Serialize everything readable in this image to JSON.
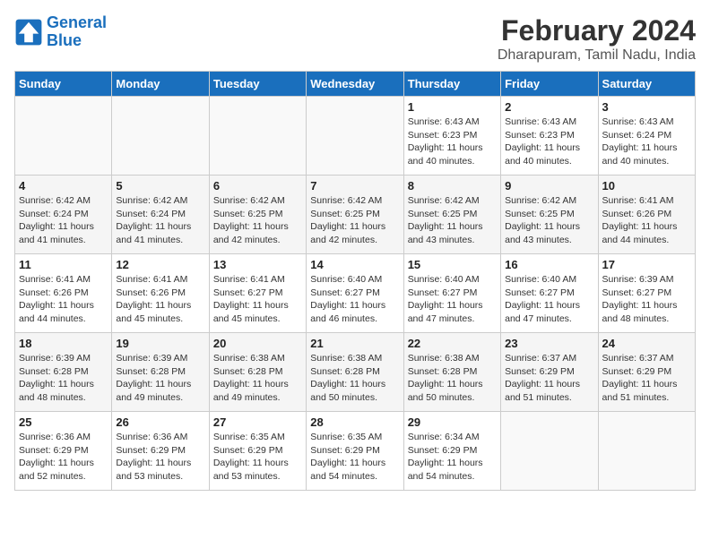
{
  "header": {
    "logo_line1": "General",
    "logo_line2": "Blue",
    "month": "February 2024",
    "location": "Dharapuram, Tamil Nadu, India"
  },
  "weekdays": [
    "Sunday",
    "Monday",
    "Tuesday",
    "Wednesday",
    "Thursday",
    "Friday",
    "Saturday"
  ],
  "weeks": [
    [
      {
        "day": "",
        "info": ""
      },
      {
        "day": "",
        "info": ""
      },
      {
        "day": "",
        "info": ""
      },
      {
        "day": "",
        "info": ""
      },
      {
        "day": "1",
        "info": "Sunrise: 6:43 AM\nSunset: 6:23 PM\nDaylight: 11 hours and 40 minutes."
      },
      {
        "day": "2",
        "info": "Sunrise: 6:43 AM\nSunset: 6:23 PM\nDaylight: 11 hours and 40 minutes."
      },
      {
        "day": "3",
        "info": "Sunrise: 6:43 AM\nSunset: 6:24 PM\nDaylight: 11 hours and 40 minutes."
      }
    ],
    [
      {
        "day": "4",
        "info": "Sunrise: 6:42 AM\nSunset: 6:24 PM\nDaylight: 11 hours and 41 minutes."
      },
      {
        "day": "5",
        "info": "Sunrise: 6:42 AM\nSunset: 6:24 PM\nDaylight: 11 hours and 41 minutes."
      },
      {
        "day": "6",
        "info": "Sunrise: 6:42 AM\nSunset: 6:25 PM\nDaylight: 11 hours and 42 minutes."
      },
      {
        "day": "7",
        "info": "Sunrise: 6:42 AM\nSunset: 6:25 PM\nDaylight: 11 hours and 42 minutes."
      },
      {
        "day": "8",
        "info": "Sunrise: 6:42 AM\nSunset: 6:25 PM\nDaylight: 11 hours and 43 minutes."
      },
      {
        "day": "9",
        "info": "Sunrise: 6:42 AM\nSunset: 6:25 PM\nDaylight: 11 hours and 43 minutes."
      },
      {
        "day": "10",
        "info": "Sunrise: 6:41 AM\nSunset: 6:26 PM\nDaylight: 11 hours and 44 minutes."
      }
    ],
    [
      {
        "day": "11",
        "info": "Sunrise: 6:41 AM\nSunset: 6:26 PM\nDaylight: 11 hours and 44 minutes."
      },
      {
        "day": "12",
        "info": "Sunrise: 6:41 AM\nSunset: 6:26 PM\nDaylight: 11 hours and 45 minutes."
      },
      {
        "day": "13",
        "info": "Sunrise: 6:41 AM\nSunset: 6:27 PM\nDaylight: 11 hours and 45 minutes."
      },
      {
        "day": "14",
        "info": "Sunrise: 6:40 AM\nSunset: 6:27 PM\nDaylight: 11 hours and 46 minutes."
      },
      {
        "day": "15",
        "info": "Sunrise: 6:40 AM\nSunset: 6:27 PM\nDaylight: 11 hours and 47 minutes."
      },
      {
        "day": "16",
        "info": "Sunrise: 6:40 AM\nSunset: 6:27 PM\nDaylight: 11 hours and 47 minutes."
      },
      {
        "day": "17",
        "info": "Sunrise: 6:39 AM\nSunset: 6:27 PM\nDaylight: 11 hours and 48 minutes."
      }
    ],
    [
      {
        "day": "18",
        "info": "Sunrise: 6:39 AM\nSunset: 6:28 PM\nDaylight: 11 hours and 48 minutes."
      },
      {
        "day": "19",
        "info": "Sunrise: 6:39 AM\nSunset: 6:28 PM\nDaylight: 11 hours and 49 minutes."
      },
      {
        "day": "20",
        "info": "Sunrise: 6:38 AM\nSunset: 6:28 PM\nDaylight: 11 hours and 49 minutes."
      },
      {
        "day": "21",
        "info": "Sunrise: 6:38 AM\nSunset: 6:28 PM\nDaylight: 11 hours and 50 minutes."
      },
      {
        "day": "22",
        "info": "Sunrise: 6:38 AM\nSunset: 6:28 PM\nDaylight: 11 hours and 50 minutes."
      },
      {
        "day": "23",
        "info": "Sunrise: 6:37 AM\nSunset: 6:29 PM\nDaylight: 11 hours and 51 minutes."
      },
      {
        "day": "24",
        "info": "Sunrise: 6:37 AM\nSunset: 6:29 PM\nDaylight: 11 hours and 51 minutes."
      }
    ],
    [
      {
        "day": "25",
        "info": "Sunrise: 6:36 AM\nSunset: 6:29 PM\nDaylight: 11 hours and 52 minutes."
      },
      {
        "day": "26",
        "info": "Sunrise: 6:36 AM\nSunset: 6:29 PM\nDaylight: 11 hours and 53 minutes."
      },
      {
        "day": "27",
        "info": "Sunrise: 6:35 AM\nSunset: 6:29 PM\nDaylight: 11 hours and 53 minutes."
      },
      {
        "day": "28",
        "info": "Sunrise: 6:35 AM\nSunset: 6:29 PM\nDaylight: 11 hours and 54 minutes."
      },
      {
        "day": "29",
        "info": "Sunrise: 6:34 AM\nSunset: 6:29 PM\nDaylight: 11 hours and 54 minutes."
      },
      {
        "day": "",
        "info": ""
      },
      {
        "day": "",
        "info": ""
      }
    ]
  ]
}
